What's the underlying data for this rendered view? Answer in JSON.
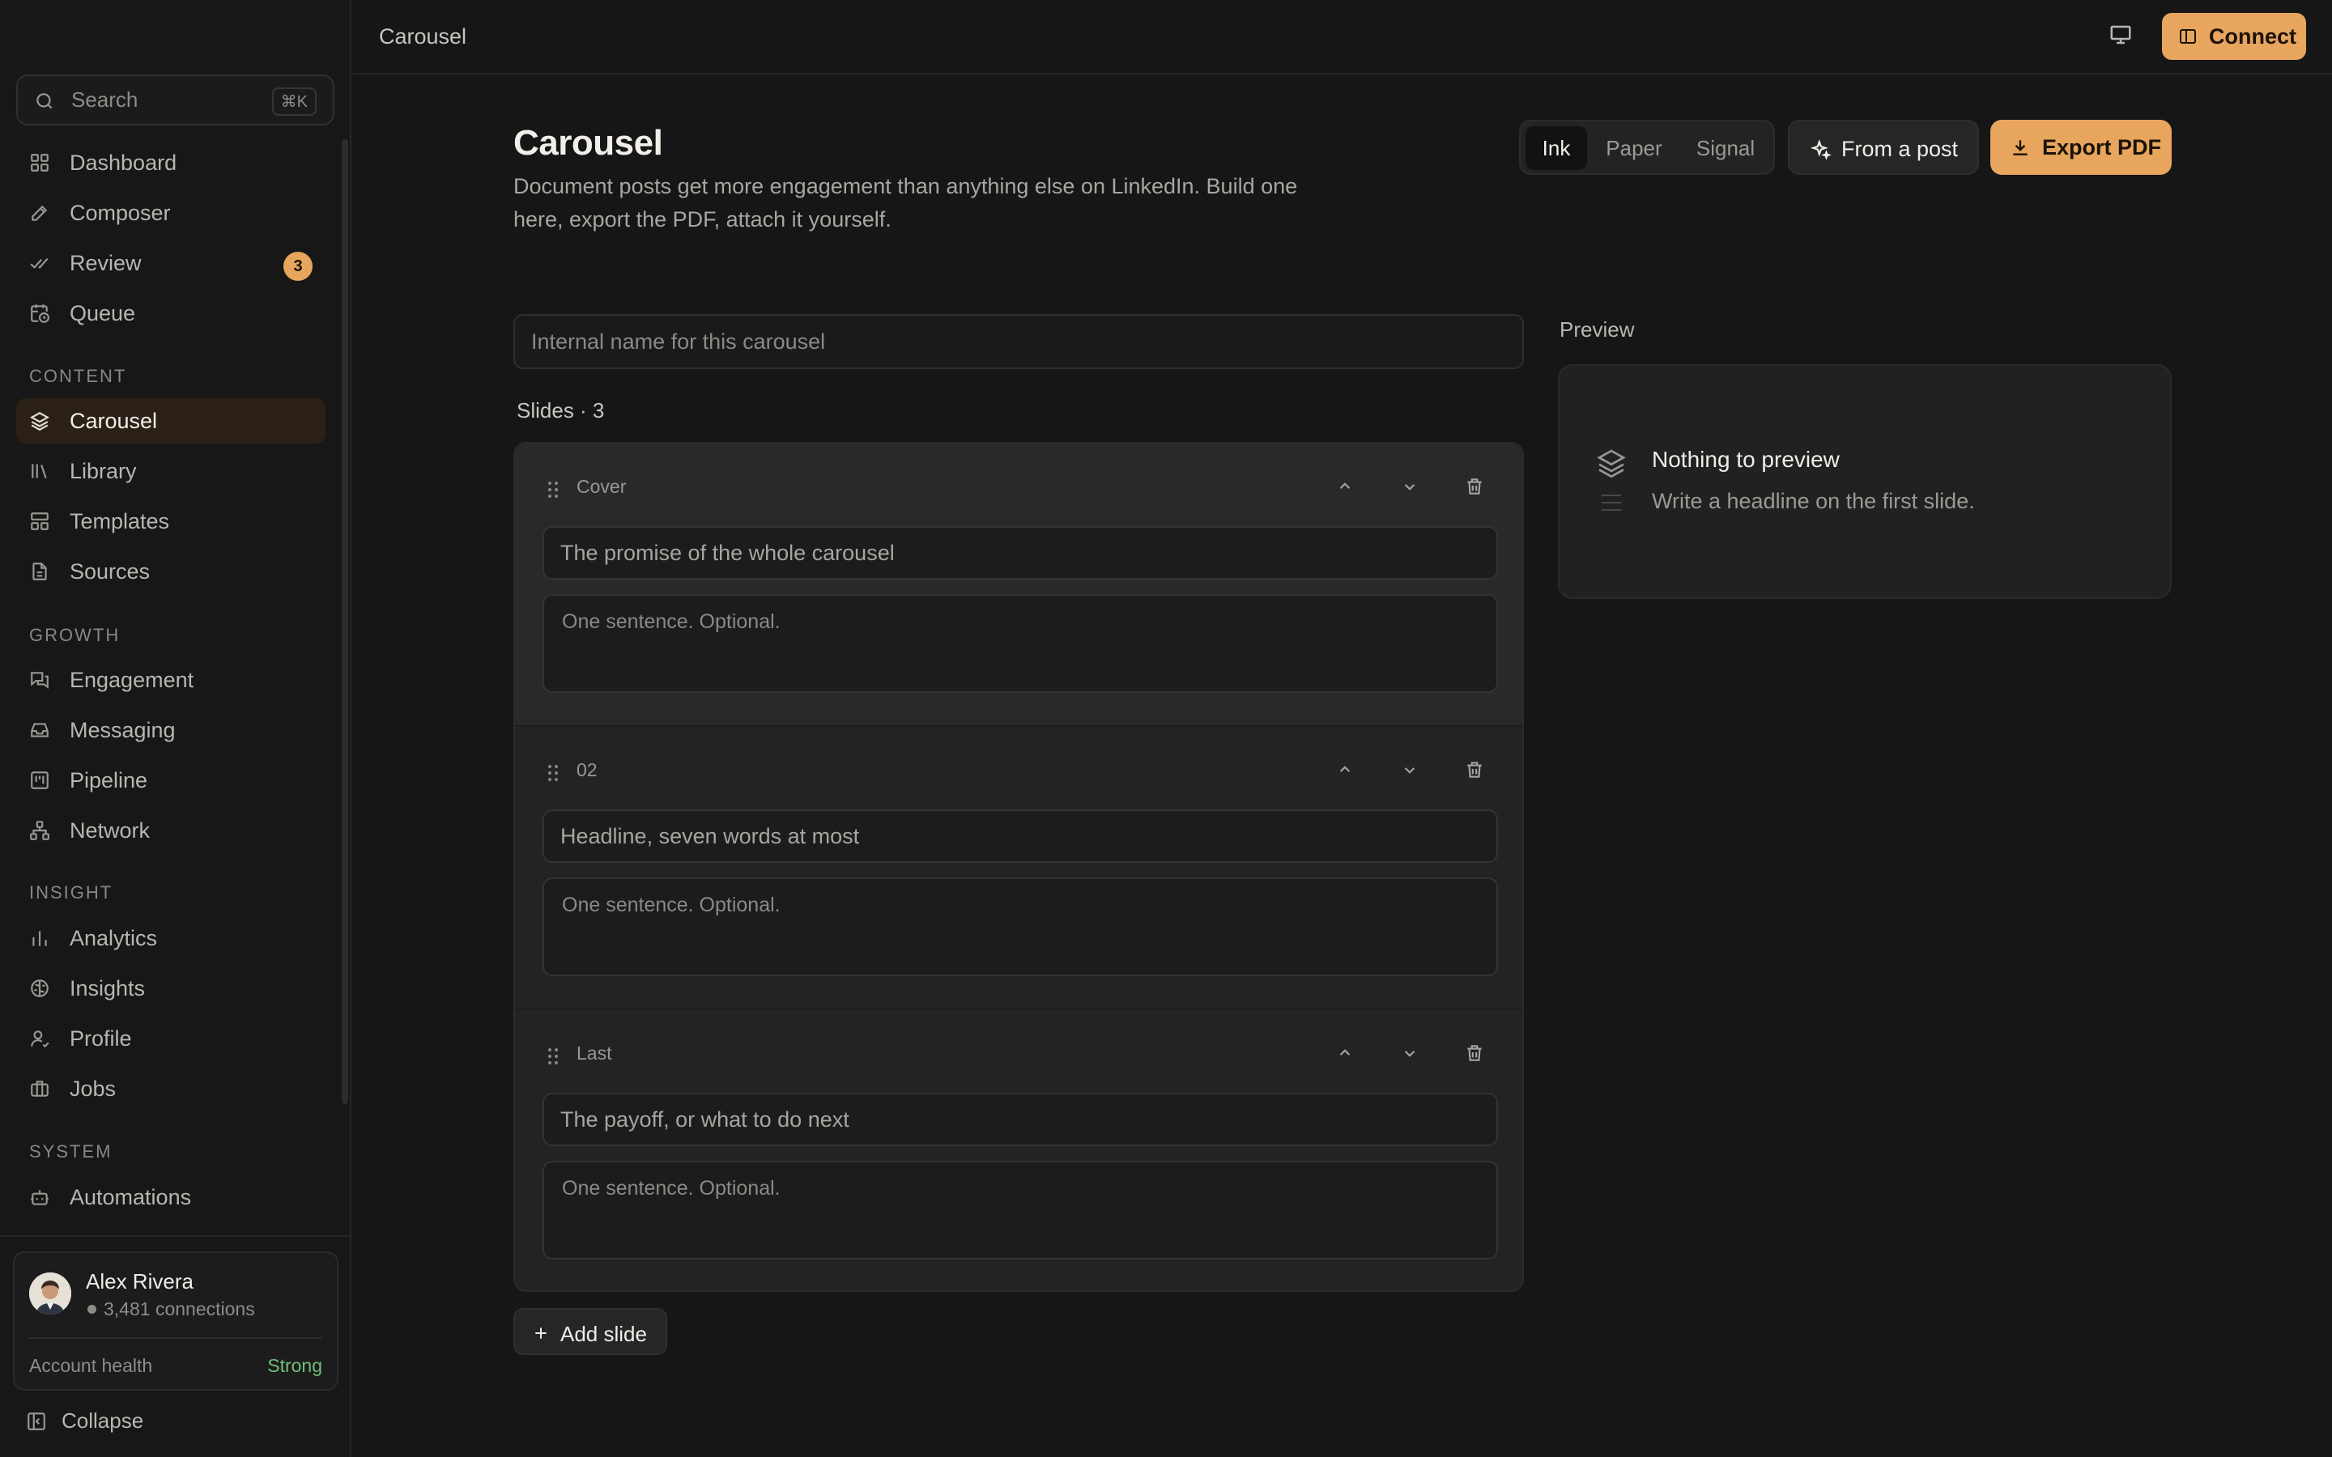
{
  "sidebar": {
    "search": {
      "label": "Search",
      "shortcut": "⌘K"
    },
    "items": [
      {
        "label": "Dashboard",
        "icon": "grid-icon"
      },
      {
        "label": "Composer",
        "icon": "pen-icon"
      },
      {
        "label": "Review",
        "icon": "double-check-icon",
        "badge": "3"
      },
      {
        "label": "Queue",
        "icon": "calendar-clock-icon"
      }
    ],
    "sections": [
      {
        "title": "CONTENT",
        "items": [
          {
            "label": "Carousel",
            "icon": "layers-icon",
            "active": true
          },
          {
            "label": "Library",
            "icon": "library-icon"
          },
          {
            "label": "Templates",
            "icon": "layout-icon"
          },
          {
            "label": "Sources",
            "icon": "document-icon"
          }
        ]
      },
      {
        "title": "GROWTH",
        "items": [
          {
            "label": "Engagement",
            "icon": "chat-icon"
          },
          {
            "label": "Messaging",
            "icon": "inbox-icon"
          },
          {
            "label": "Pipeline",
            "icon": "kanban-icon"
          },
          {
            "label": "Network",
            "icon": "network-icon"
          }
        ]
      },
      {
        "title": "INSIGHT",
        "items": [
          {
            "label": "Analytics",
            "icon": "bar-chart-icon"
          },
          {
            "label": "Insights",
            "icon": "brain-icon"
          },
          {
            "label": "Profile",
            "icon": "user-icon"
          },
          {
            "label": "Jobs",
            "icon": "briefcase-icon"
          }
        ]
      },
      {
        "title": "SYSTEM",
        "items": [
          {
            "label": "Automations",
            "icon": "bot-icon"
          }
        ]
      }
    ],
    "profile": {
      "name": "Alex Rivera",
      "connections": "3,481 connections",
      "health_label": "Account health",
      "health_value": "Strong"
    },
    "collapse_label": "Collapse"
  },
  "topbar": {
    "breadcrumb": "Carousel",
    "connect_label": "Connect"
  },
  "header": {
    "title": "Carousel",
    "description": "Document posts get more engagement than anything else on LinkedIn. Build one here, export the PDF, attach it yourself.",
    "themes": [
      "Ink",
      "Paper",
      "Signal"
    ],
    "active_theme": "Ink",
    "from_post_label": "From a post",
    "export_label": "Export PDF"
  },
  "form": {
    "name_placeholder": "Internal name for this carousel",
    "name_value": "",
    "slides_label": "Slides · 3",
    "slides": [
      {
        "tag": "Cover",
        "headline_placeholder": "The promise of the whole carousel",
        "sub_placeholder": "One sentence. Optional."
      },
      {
        "tag": "02",
        "headline_placeholder": "Headline, seven words at most",
        "sub_placeholder": "One sentence. Optional."
      },
      {
        "tag": "Last",
        "headline_placeholder": "The payoff, or what to do next",
        "sub_placeholder": "One sentence. Optional."
      }
    ],
    "add_slide_label": "Add slide"
  },
  "preview": {
    "label": "Preview",
    "empty_title": "Nothing to preview",
    "empty_sub": "Write a headline on the first slide."
  },
  "colors": {
    "accent": "#e8a55e",
    "background": "#161616",
    "success": "#6fbf79"
  }
}
